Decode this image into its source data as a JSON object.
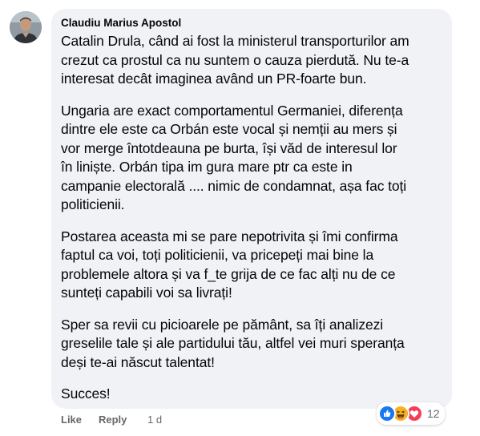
{
  "comment": {
    "author": "Claudiu Marius Apostol",
    "paragraphs": [
      {
        "lines": [
          "Catalin Drula, când ai fost la ministerul transporturilor am",
          "crezut ca prostul ca nu suntem o cauza pierdută. Nu te-a",
          "interesat decât imaginea având un PR-foarte bun."
        ]
      },
      {
        "lines": [
          "Ungaria are exact comportamentul Germaniei, diferența",
          "dintre ele este ca Orbán este vocal și nemții au mers și",
          "vor merge întotdeauna pe burta, își văd de interesul lor",
          "în liniște. Orbán tipa im gura mare ptr ca este in",
          "campanie electorală .... nimic de condamnat, așa fac toți",
          "politicienii."
        ]
      },
      {
        "lines": [
          "Postarea aceasta mi se pare nepotrivita și îmi confirma",
          "faptul ca voi, toți politicienii, va pricepeți mai bine la",
          "problemele altora și va f_te grija de ce fac alți nu de ce",
          "sunteți capabili voi sa livrați!"
        ]
      },
      {
        "lines": [
          "Sper sa revii cu picioarele pe pământ, sa îți analizezi",
          "greselile tale și ale partidului tău, altfel vei muri speranța",
          "deși te-ai născut talentat!"
        ]
      },
      {
        "lines": [
          "Succes!"
        ]
      }
    ]
  },
  "actions": {
    "like_label": "Like",
    "reply_label": "Reply",
    "timestamp": "1 d"
  },
  "reactions": {
    "icons": [
      "like-icon",
      "haha-icon",
      "love-icon"
    ],
    "count": "12"
  },
  "colors": {
    "bubble_bg": "#f0f2f5",
    "text": "#050505",
    "secondary_text": "#65676b",
    "like_blue": "#1877f2",
    "love_red": "#f33e58",
    "haha_yellow": "#f7b125"
  }
}
